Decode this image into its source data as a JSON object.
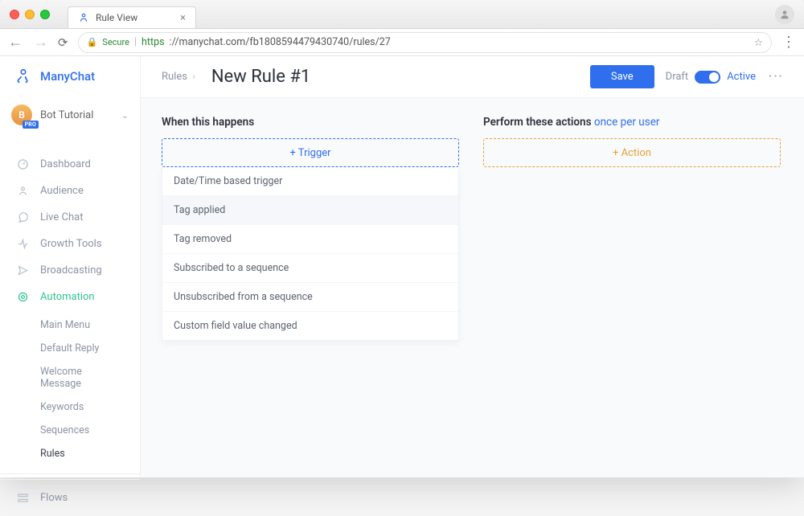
{
  "browser": {
    "tab_title": "Rule View",
    "secure_label": "Secure",
    "url_proto": "https",
    "url_rest": "://manychat.com/fb1808594479430740/rules/27"
  },
  "brand": {
    "name": "ManyChat"
  },
  "workspace": {
    "name": "Bot Tutorial",
    "avatar_letter": "B",
    "badge": "PRO"
  },
  "nav": [
    {
      "label": "Dashboard",
      "icon": "dashboard"
    },
    {
      "label": "Audience",
      "icon": "audience"
    },
    {
      "label": "Live Chat",
      "icon": "chat"
    },
    {
      "label": "Growth Tools",
      "icon": "growth"
    },
    {
      "label": "Broadcasting",
      "icon": "broadcast"
    },
    {
      "label": "Automation",
      "icon": "automation",
      "active": true
    },
    {
      "label": "Flows",
      "icon": "flows"
    }
  ],
  "automation_sub": [
    {
      "label": "Main Menu"
    },
    {
      "label": "Default Reply"
    },
    {
      "label": "Welcome Message"
    },
    {
      "label": "Keywords"
    },
    {
      "label": "Sequences"
    },
    {
      "label": "Rules",
      "current": true
    }
  ],
  "header": {
    "breadcrumb_root": "Rules",
    "title": "New Rule #1",
    "save": "Save",
    "draft": "Draft",
    "active": "Active"
  },
  "columns": {
    "trigger_heading": "When this happens",
    "trigger_button": "+ Trigger",
    "action_heading_prefix": "Perform these actions ",
    "action_heading_link": "once per user",
    "action_button": "+ Action"
  },
  "trigger_options": [
    "Date/Time based trigger",
    "Tag applied",
    "Tag removed",
    "Subscribed to a sequence",
    "Unsubscribed from a sequence",
    "Custom field value changed"
  ],
  "trigger_hover_index": 1
}
